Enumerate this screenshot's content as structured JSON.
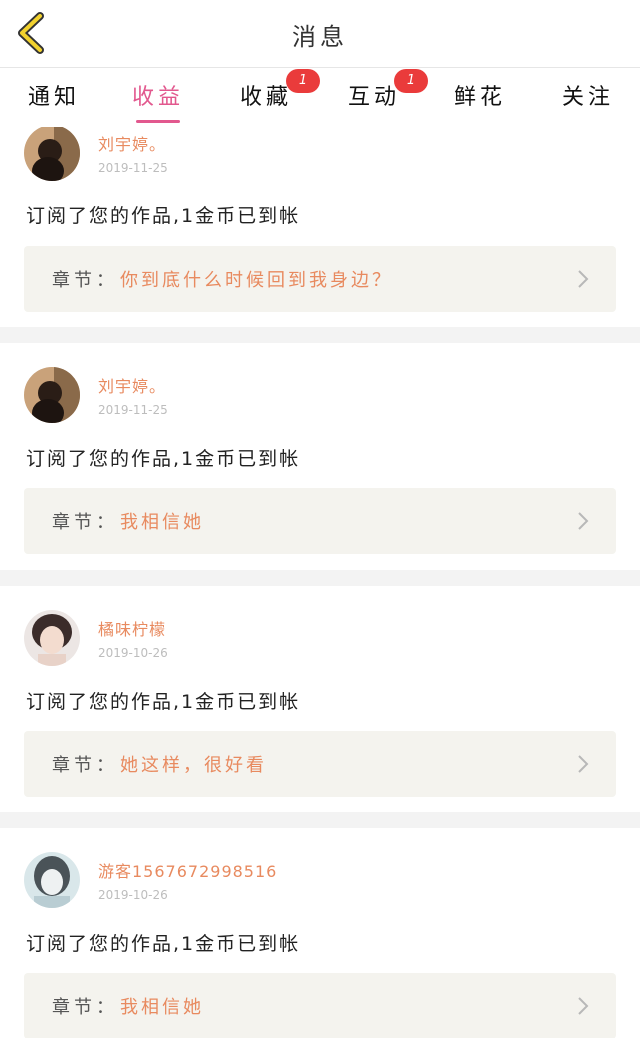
{
  "header": {
    "title": "消息",
    "accent": "#f2d22e"
  },
  "tabs": [
    {
      "label": "通知",
      "active": false,
      "badge": ""
    },
    {
      "label": "收益",
      "active": true,
      "badge": ""
    },
    {
      "label": "收藏",
      "active": false,
      "badge": "1"
    },
    {
      "label": "互动",
      "active": false,
      "badge": "1"
    },
    {
      "label": "鲜花",
      "active": false,
      "badge": ""
    },
    {
      "label": "关注",
      "active": false,
      "badge": ""
    }
  ],
  "items": [
    {
      "username": "刘宇婷。",
      "date": "2019-11-25",
      "message": "订阅了您的作品,1金币已到帐",
      "chapter_label": "章节：",
      "chapter_title": "你到底什么时候回到我身边？"
    },
    {
      "username": "刘宇婷。",
      "date": "2019-11-25",
      "message": "订阅了您的作品,1金币已到帐",
      "chapter_label": "章节：",
      "chapter_title": "我相信她"
    },
    {
      "username": "橘味柠檬",
      "date": "2019-10-26",
      "message": "订阅了您的作品,1金币已到帐",
      "chapter_label": "章节：",
      "chapter_title": "她这样，很好看"
    },
    {
      "username": "游客1567672998516",
      "date": "2019-10-26",
      "message": "订阅了您的作品,1金币已到帐",
      "chapter_label": "章节：",
      "chapter_title": "我相信她"
    }
  ],
  "colors": {
    "active_tab": "#e2588e",
    "username": "#e88a5f",
    "badge": "#ea3b3b",
    "chapter_bg": "#f4f3ee"
  },
  "icons": {
    "back": "chevron-left-icon",
    "row_arrow": "chevron-right-icon"
  }
}
